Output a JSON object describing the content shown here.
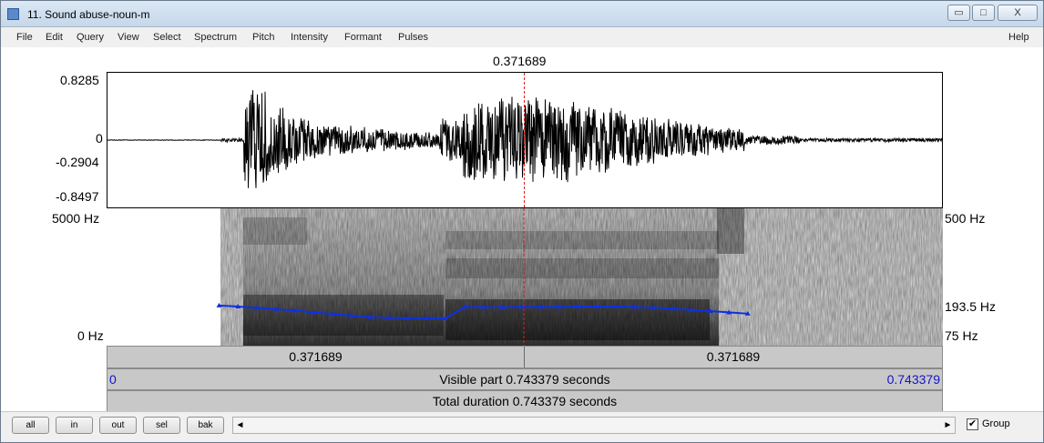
{
  "window": {
    "title": "11. Sound abuse-noun-m",
    "controls": {
      "minimize": "▭",
      "maximize": "□",
      "close": "X"
    }
  },
  "menu": [
    "File",
    "Edit",
    "Query",
    "View",
    "Select",
    "Spectrum",
    "Pitch",
    "Intensity",
    "Formant",
    "Pulses"
  ],
  "help_label": "Help",
  "cursor": {
    "time_label": "0.371689",
    "time_seconds": 0.371689
  },
  "waveform": {
    "y_max": "0.8285",
    "y_zero": "0",
    "y_cursor_value": "-0.2904",
    "y_min": "-0.8497"
  },
  "spectrogram": {
    "freq_top": "5000 Hz",
    "freq_bottom": "0 Hz",
    "pitch_top": "500 Hz",
    "pitch_cursor": "193.5 Hz",
    "pitch_bottom": "75 Hz"
  },
  "time_bar": {
    "left_segment": "0.371689",
    "right_segment": "0.371689"
  },
  "visible_bar": {
    "start": "0",
    "text": "Visible part 0.743379 seconds",
    "end": "0.743379"
  },
  "total_bar": {
    "text": "Total duration 0.743379 seconds"
  },
  "pitch_track": {
    "time_range": [
      0.1,
      0.57
    ],
    "values_hz": [
      201,
      198,
      194,
      190,
      186,
      180,
      175,
      170,
      166,
      163,
      162,
      162,
      162,
      197,
      196,
      196,
      197,
      197,
      197,
      198,
      198,
      198,
      197,
      195,
      192,
      188,
      184,
      180,
      176
    ]
  },
  "bottom": {
    "buttons": [
      "all",
      "in",
      "out",
      "sel",
      "bak"
    ],
    "scroll_left": "◄",
    "scroll_right": "►",
    "group_checked": "✔",
    "group_label": "Group"
  },
  "colors": {
    "cursor": "#e02020",
    "axis_value": "#1414c8",
    "pitch": "#1030e0"
  }
}
